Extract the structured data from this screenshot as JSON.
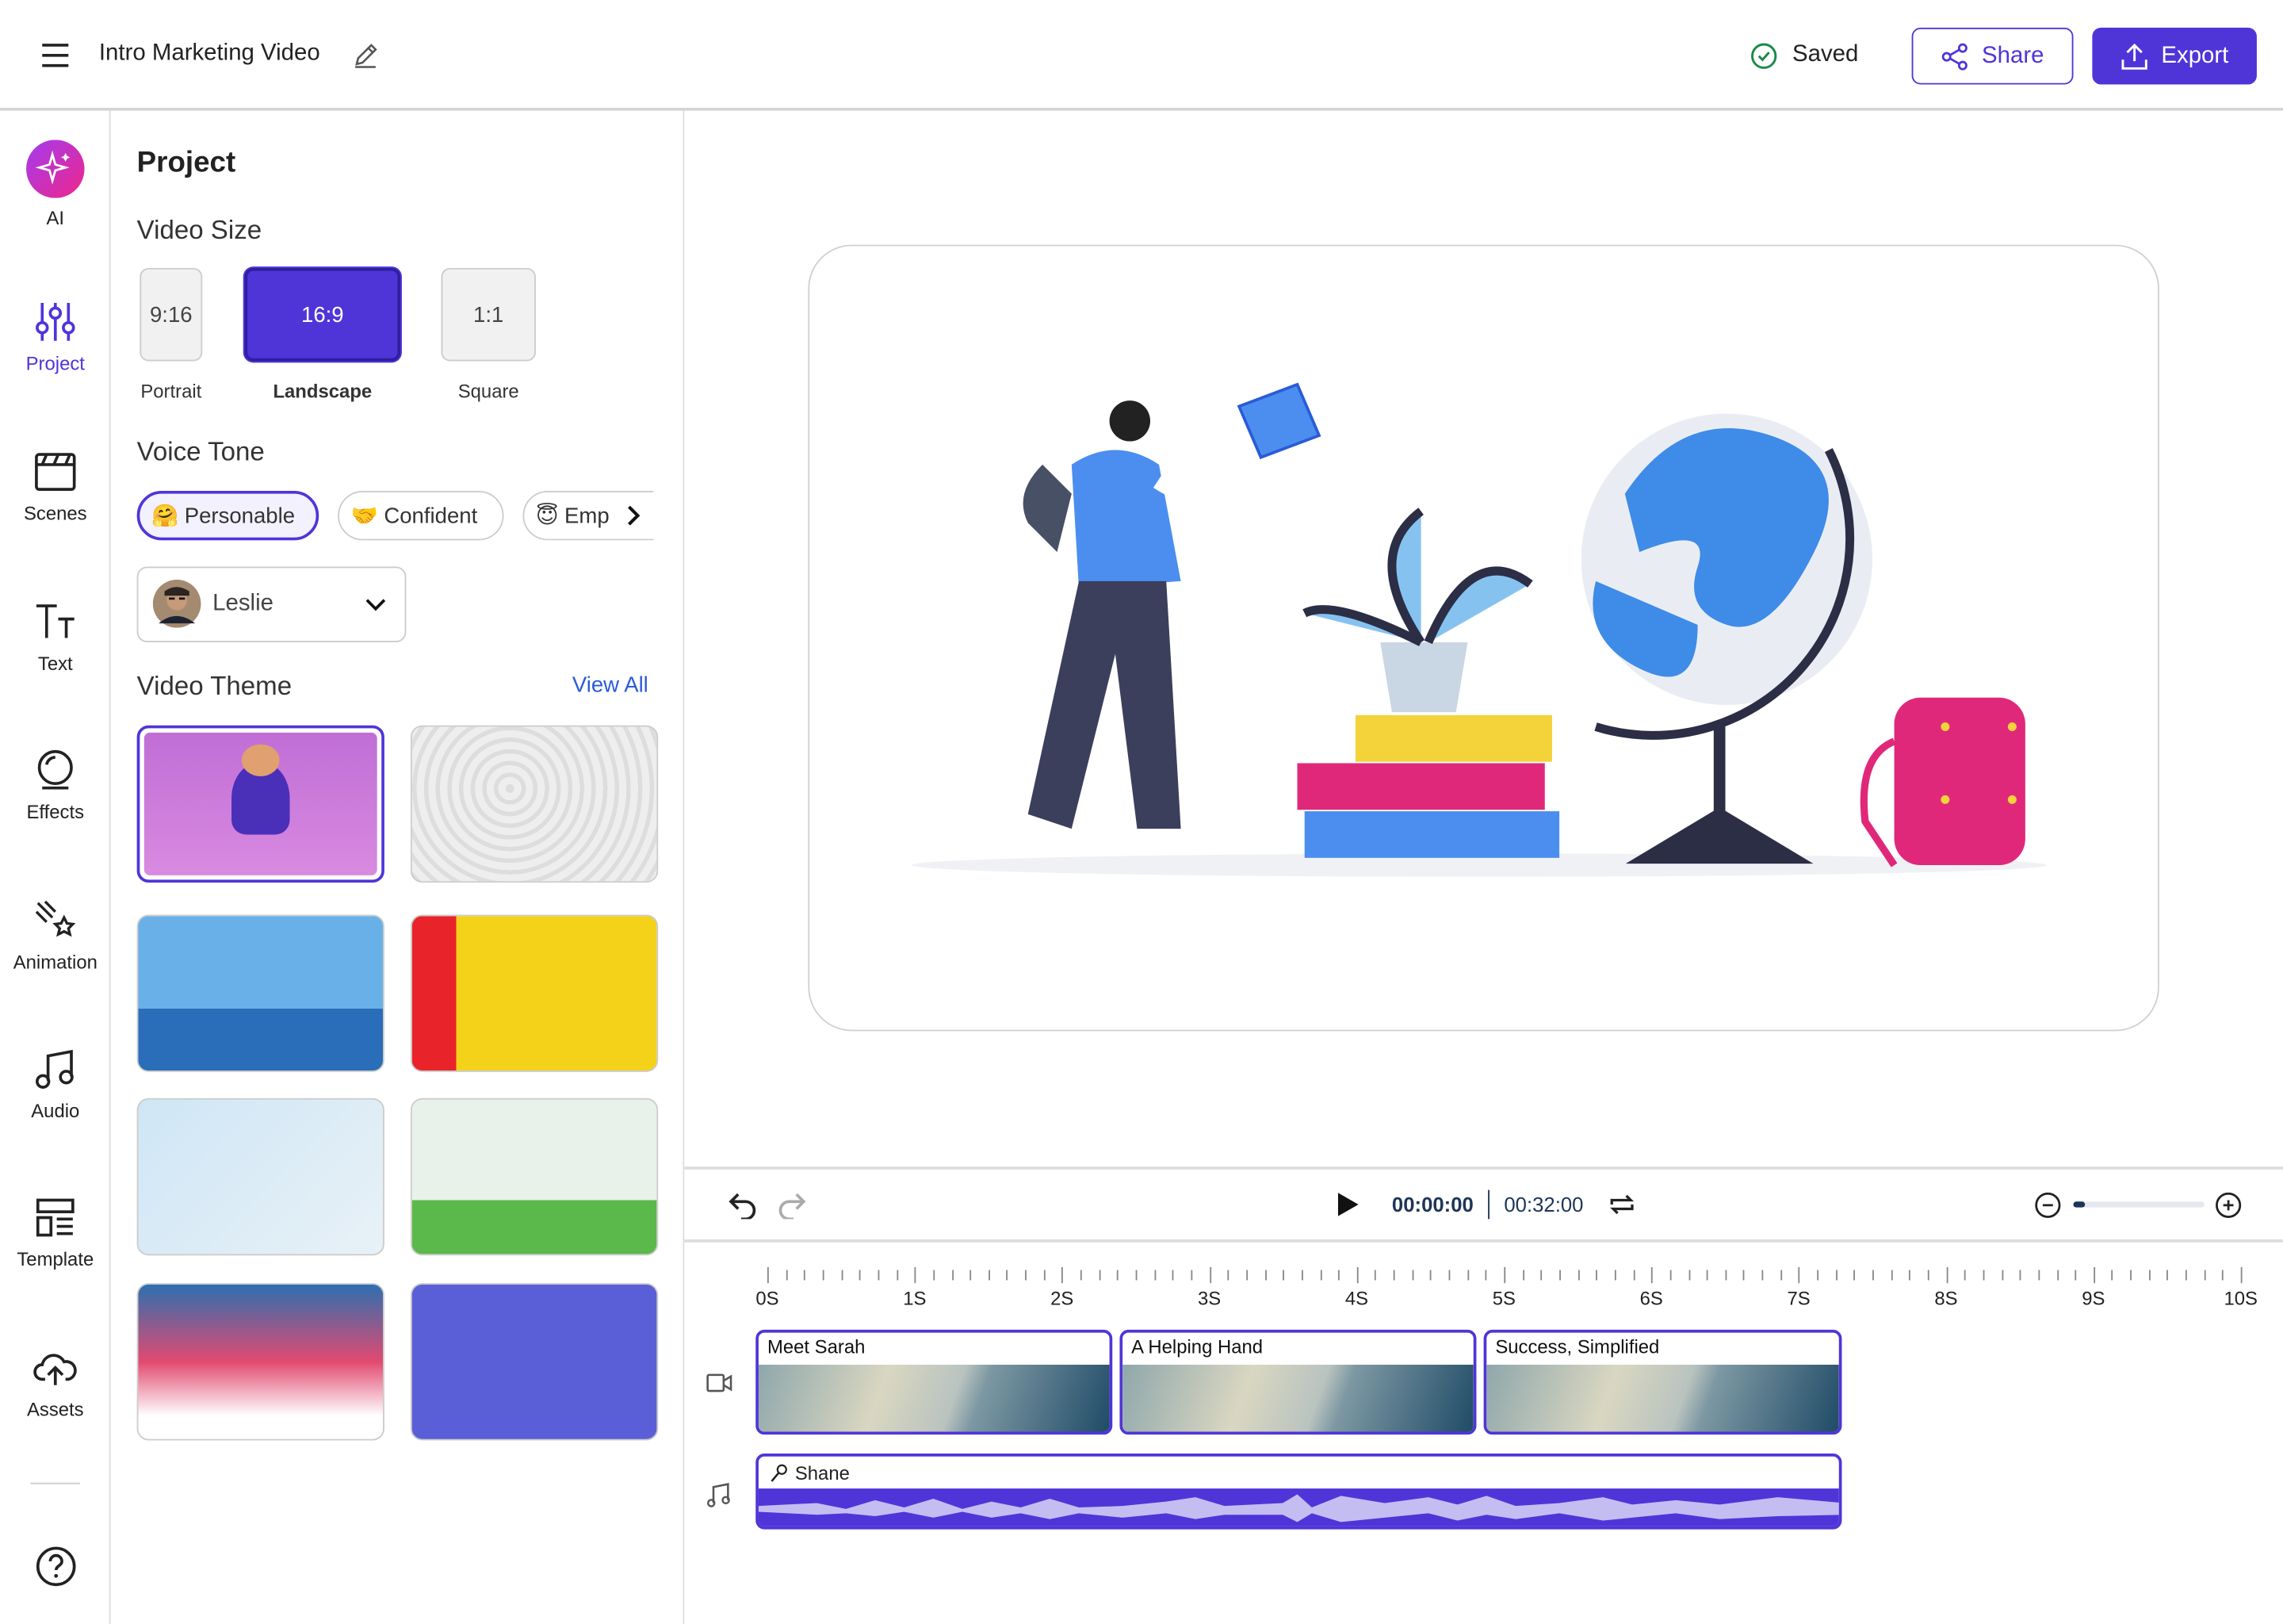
{
  "header": {
    "title": "Intro Marketing Video",
    "status": "Saved",
    "share_label": "Share",
    "export_label": "Export",
    "accent": "#4f35d8",
    "status_color": "#1a8a4a"
  },
  "rail": {
    "items": [
      {
        "label": "AI",
        "icon": "sparkle-icon"
      },
      {
        "label": "Project",
        "icon": "sliders-icon",
        "active": true
      },
      {
        "label": "Scenes",
        "icon": "clapperboard-icon"
      },
      {
        "label": "Text",
        "icon": "text-icon"
      },
      {
        "label": "Effects",
        "icon": "effects-icon"
      },
      {
        "label": "Animation",
        "icon": "animation-icon"
      },
      {
        "label": "Audio",
        "icon": "music-icon"
      },
      {
        "label": "Template",
        "icon": "template-icon"
      },
      {
        "label": "Assets",
        "icon": "cloud-upload-icon"
      }
    ],
    "help_icon": "help-icon"
  },
  "panel": {
    "title": "Project",
    "video_size": {
      "heading": "Video Size",
      "options": [
        {
          "ratio": "9:16",
          "label": "Portrait"
        },
        {
          "ratio": "16:9",
          "label": "Landscape",
          "selected": true
        },
        {
          "ratio": "1:1",
          "label": "Square"
        }
      ]
    },
    "voice_tone": {
      "heading": "Voice Tone",
      "chips": [
        {
          "emoji": "🤗",
          "label": "Personable",
          "selected": true
        },
        {
          "emoji": "🤝",
          "label": "Confident"
        },
        {
          "emoji": "😇",
          "label": "Emp"
        }
      ],
      "voice": "Leslie"
    },
    "video_theme": {
      "heading": "Video Theme",
      "view_all": "View All"
    }
  },
  "timeline": {
    "current_time": "00:00:00",
    "total_time": "00:32:00",
    "ruler": [
      "0S",
      "1S",
      "2S",
      "3S",
      "4S",
      "5S",
      "6S",
      "7S",
      "8S",
      "9S",
      "10S"
    ],
    "clips": [
      "Meet Sarah",
      "A Helping Hand",
      "Success, Simplified"
    ],
    "audio_clip": "Shane"
  }
}
